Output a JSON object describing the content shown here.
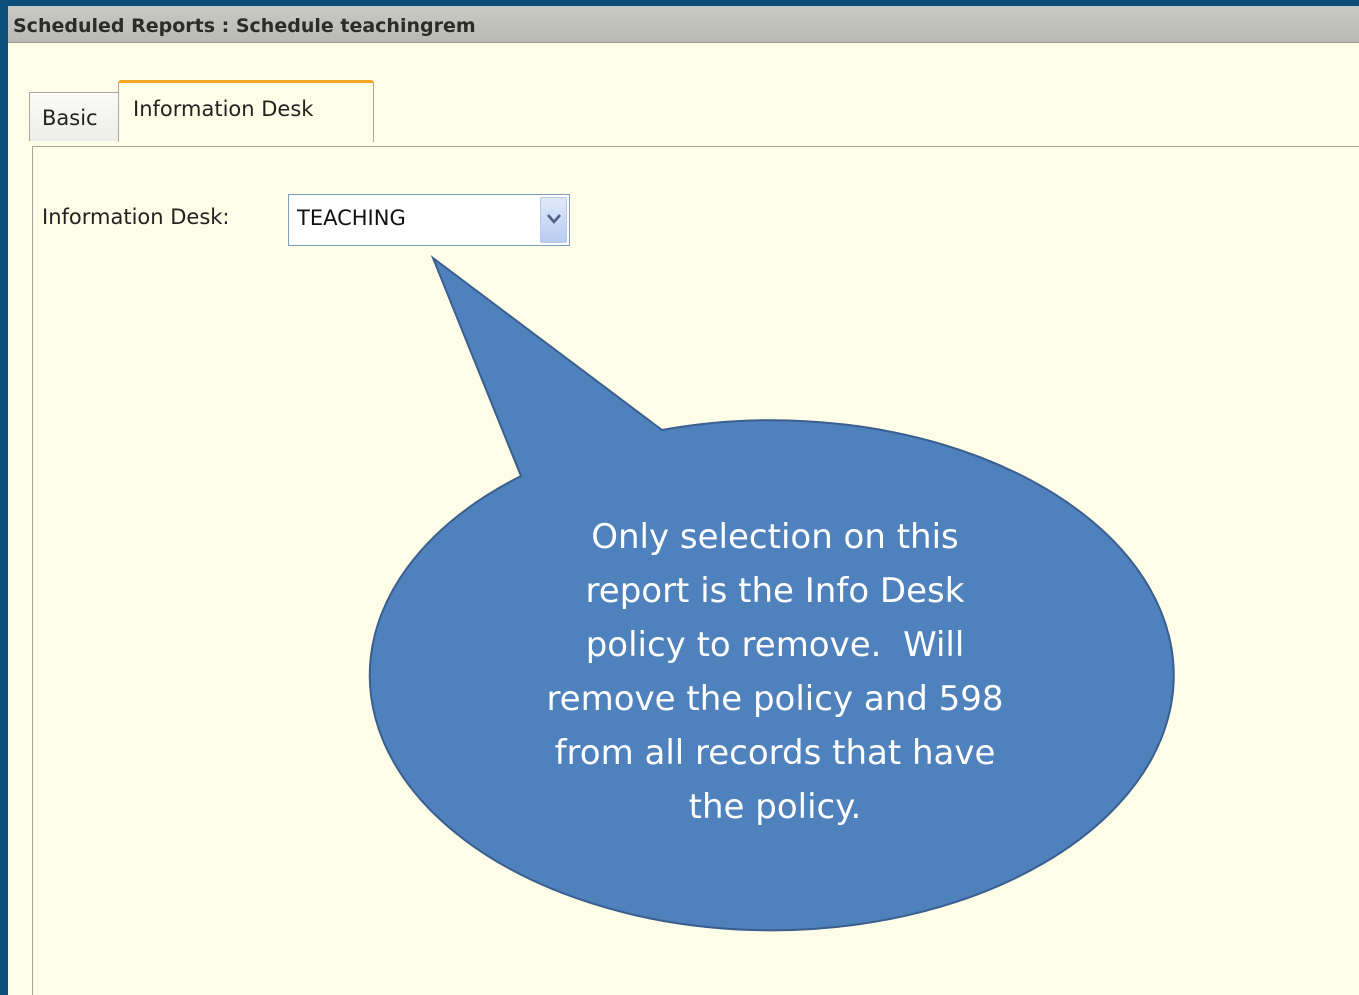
{
  "window": {
    "title": "Scheduled Reports : Schedule teachingrem"
  },
  "tabs": [
    {
      "label": "Basic",
      "active": false
    },
    {
      "label": "Information Desk",
      "active": true
    }
  ],
  "form": {
    "information_desk_label": "Information Desk:",
    "information_desk_value": "TEACHING"
  },
  "callout": {
    "lines": [
      "Only selection on this",
      "report is the Info Desk",
      "policy to remove.  Will",
      "remove the policy and 598",
      "from all records that have",
      "the policy."
    ]
  },
  "colors": {
    "background_border": "#0d4f7c",
    "panel": "#fefee8",
    "callout_fill": "#4f81bd",
    "callout_stroke": "#3a5f8f",
    "active_tab_accent": "#f5a623"
  },
  "icons": {
    "dropdown": "chevron-down-icon"
  }
}
